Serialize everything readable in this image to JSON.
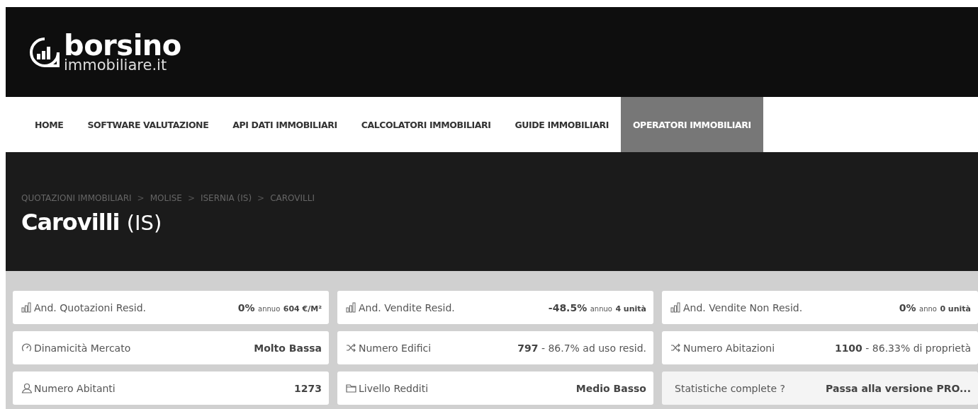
{
  "logo": {
    "name": "borsino",
    "sub": "immobiliare.it"
  },
  "nav": [
    {
      "label": "HOME",
      "selected": false
    },
    {
      "label": "SOFTWARE VALUTAZIONE",
      "selected": false
    },
    {
      "label": "API DATI IMMOBILIARI",
      "selected": false
    },
    {
      "label": "CALCOLATORI IMMOBILIARI",
      "selected": false
    },
    {
      "label": "GUIDE IMMOBILIARI",
      "selected": false
    },
    {
      "label": "OPERATORI IMMOBILIARI",
      "selected": true
    }
  ],
  "breadcrumb": [
    "QUOTAZIONI IMMOBILIARI",
    "MOLISE",
    "ISERNIA (IS)",
    "CAROVILLI"
  ],
  "breadcrumb_separator": ">",
  "title": {
    "name": "Carovilli",
    "province": "(IS)"
  },
  "stats": [
    {
      "kind": "bars",
      "label": "And. Quotazioni Resid.",
      "main": "0%",
      "period": "annuo",
      "amount": "604 €/M²"
    },
    {
      "kind": "bars",
      "label": "And. Vendite Resid.",
      "main": "-48.5%",
      "period": "annuo",
      "amount": "4 unità"
    },
    {
      "kind": "bars",
      "label": "And. Vendite Non Resid.",
      "main": "0%",
      "period": "anno",
      "amount": "0 unità"
    },
    {
      "kind": "gauge",
      "label": "Dinamicità Mercato",
      "main": "Molto Bassa"
    },
    {
      "kind": "shuffle",
      "label": "Numero Edifici",
      "main": "797",
      "detail": "- 86.7% ad uso resid."
    },
    {
      "kind": "shuffle",
      "label": "Numero Abitazioni",
      "main": "1100",
      "detail": "- 86.33% di proprietà"
    },
    {
      "kind": "person",
      "label": "Numero Abitanti",
      "main": "1273"
    },
    {
      "kind": "folder",
      "label": "Livello Redditi",
      "main": "Medio Basso"
    },
    {
      "kind": "promo",
      "label": "Statistiche complete ?",
      "main": "Passa alla versione PRO..."
    }
  ]
}
